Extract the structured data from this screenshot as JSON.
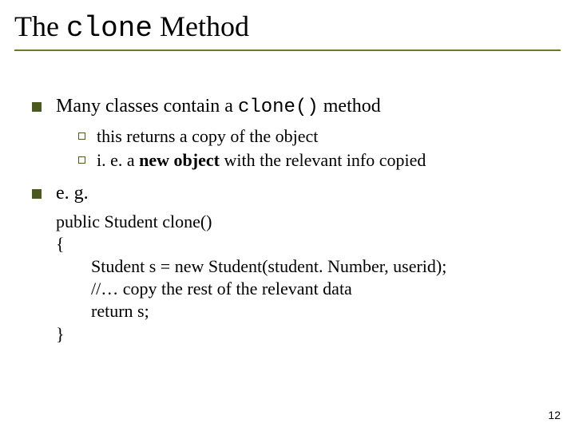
{
  "title": {
    "pre": "The ",
    "mono": "clone",
    "post": " Method"
  },
  "bullets": {
    "b1": {
      "pre": "Many classes contain a ",
      "mono": "clone()",
      "post": " method"
    },
    "b1_sub1": "this returns a copy of the object",
    "b1_sub2_pre": "i. e. a ",
    "b1_sub2_bold": "new object",
    "b1_sub2_post": " with the relevant info copied",
    "b2": "e. g."
  },
  "code": {
    "l1": "public Student clone()",
    "l2": "{",
    "l3": "Student s = new Student(student. Number, userid);",
    "l4": "//… copy the rest of the relevant data",
    "l5": "return s;",
    "l6": "}"
  },
  "page_number": "12"
}
